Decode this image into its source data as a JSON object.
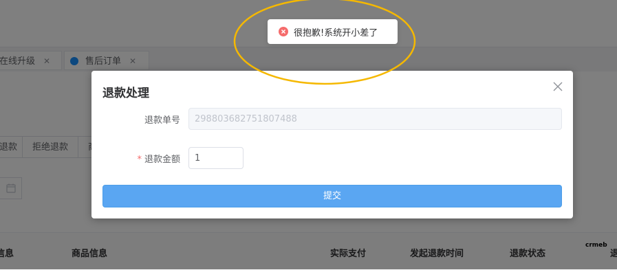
{
  "background": {
    "tabs": [
      {
        "label": "在线升级"
      },
      {
        "label": "售后订单"
      }
    ],
    "buttons": [
      "退款",
      "拒绝退款",
      "商"
    ],
    "table_headers": [
      "信息",
      "商品信息",
      "实际支付",
      "发起退款时间",
      "退款状态",
      "退"
    ],
    "logo_text": "crmeb"
  },
  "toast": {
    "icon": "error-circle-icon",
    "message": "很抱歉!系统开小差了",
    "color": "#f56c6c"
  },
  "dialog": {
    "title": "退款处理",
    "fields": [
      {
        "label": "退款单号",
        "value": "298803682751807488",
        "disabled": true,
        "required": false
      },
      {
        "label": "退款金额",
        "value": "1",
        "disabled": false,
        "required": true,
        "required_mark": "*"
      }
    ],
    "submit_label": "提交"
  },
  "colors": {
    "primary": "#5aa6f2",
    "annotation": "#f5b800",
    "error": "#f56c6c"
  }
}
